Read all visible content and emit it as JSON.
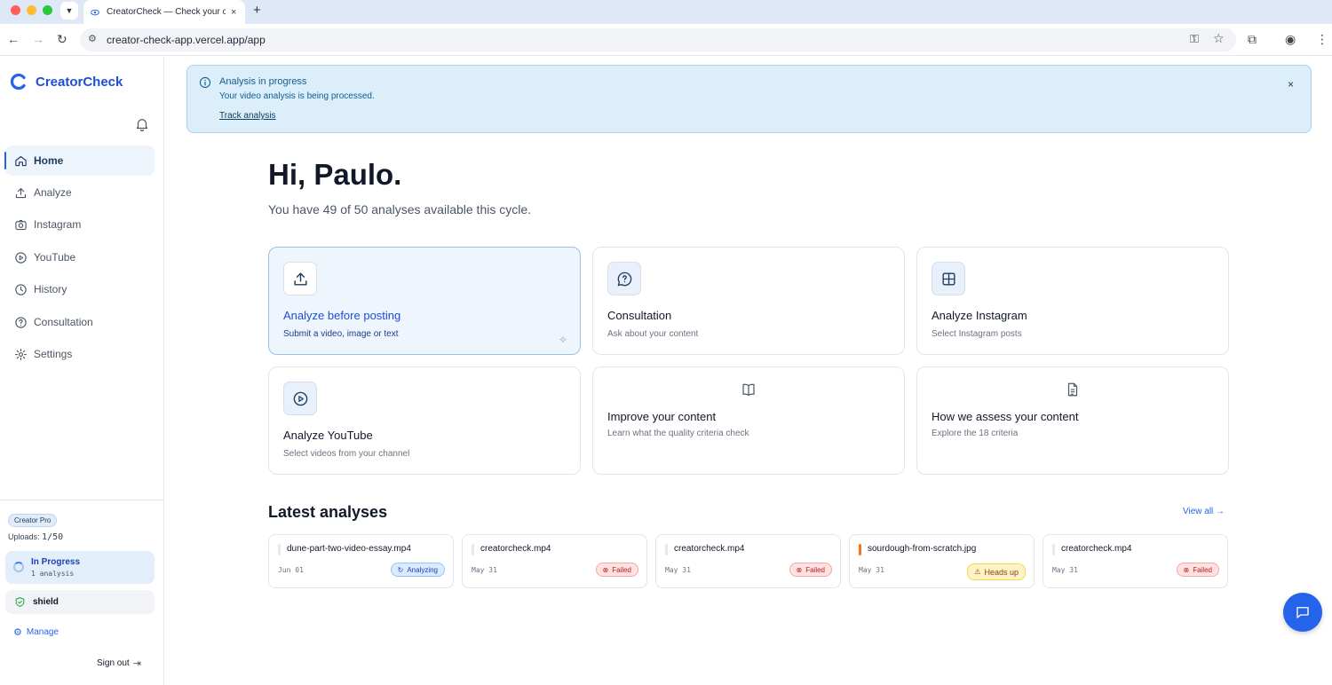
{
  "browser": {
    "tab_title": "CreatorCheck — Check your content",
    "url": "creator-check-app.vercel.app/app",
    "new_tab": "+",
    "tab_close": "×"
  },
  "app": {
    "name": "CreatorCheck",
    "brand_color": "#1d4ed8"
  },
  "sidebar": {
    "items": [
      {
        "label": "Home",
        "icon": "home-icon",
        "active": true
      },
      {
        "label": "Analyze",
        "icon": "upload-icon"
      },
      {
        "label": "Instagram",
        "icon": "camera-icon"
      },
      {
        "label": "YouTube",
        "icon": "play-circle-icon"
      },
      {
        "label": "History",
        "icon": "clock-icon"
      },
      {
        "label": "Consultation",
        "icon": "help-circle-icon"
      },
      {
        "label": "Settings",
        "icon": "gear-icon"
      }
    ],
    "plan": "Creator Pro",
    "uploads_label": "Uploads:",
    "uploads_value": "1/50",
    "in_progress_title": "In Progress",
    "in_progress_sub": "1 analysis",
    "shield_label": "shield",
    "manage_label": "Manage",
    "signout_label": "Sign out"
  },
  "alert": {
    "title": "Analysis in progress",
    "body": "Your video analysis is being processed.",
    "link": "Track analysis",
    "close": "×"
  },
  "main": {
    "greeting": "Hi, Paulo.",
    "subtitle": "You have 49 of 50 analyses available this cycle.",
    "cards": [
      {
        "title": "Analyze before posting",
        "subtitle": "Submit a video, image or text",
        "icon": "upload-icon"
      },
      {
        "title": "Consultation",
        "subtitle": "Ask about your content",
        "icon": "chat-question-icon"
      },
      {
        "title": "Analyze Instagram",
        "subtitle": "Select Instagram posts",
        "icon": "grid-icon"
      },
      {
        "title": "Analyze YouTube",
        "subtitle": "Select videos from your channel",
        "icon": "play-circle-icon"
      },
      {
        "title": "Improve your content",
        "subtitle": "Learn what the quality criteria check",
        "icon": "book-icon"
      },
      {
        "title": "How we assess your content",
        "subtitle": "Explore the 18 criteria",
        "icon": "document-icon"
      }
    ],
    "latest_title": "Latest analyses",
    "view_all": "View all →",
    "analyses": [
      {
        "file": "dune-part-two-video-essay.mp4",
        "date": "Jun 01",
        "status": "Analyzing"
      },
      {
        "file": "creatorcheck.mp4",
        "date": "May 31",
        "status": "Failed"
      },
      {
        "file": "creatorcheck.mp4",
        "date": "May 31",
        "status": "Failed"
      },
      {
        "file": "sourdough-from-scratch.jpg",
        "date": "May 31",
        "status": "Heads up"
      },
      {
        "file": "creatorcheck.mp4",
        "date": "May 31",
        "status": "Failed"
      }
    ]
  }
}
